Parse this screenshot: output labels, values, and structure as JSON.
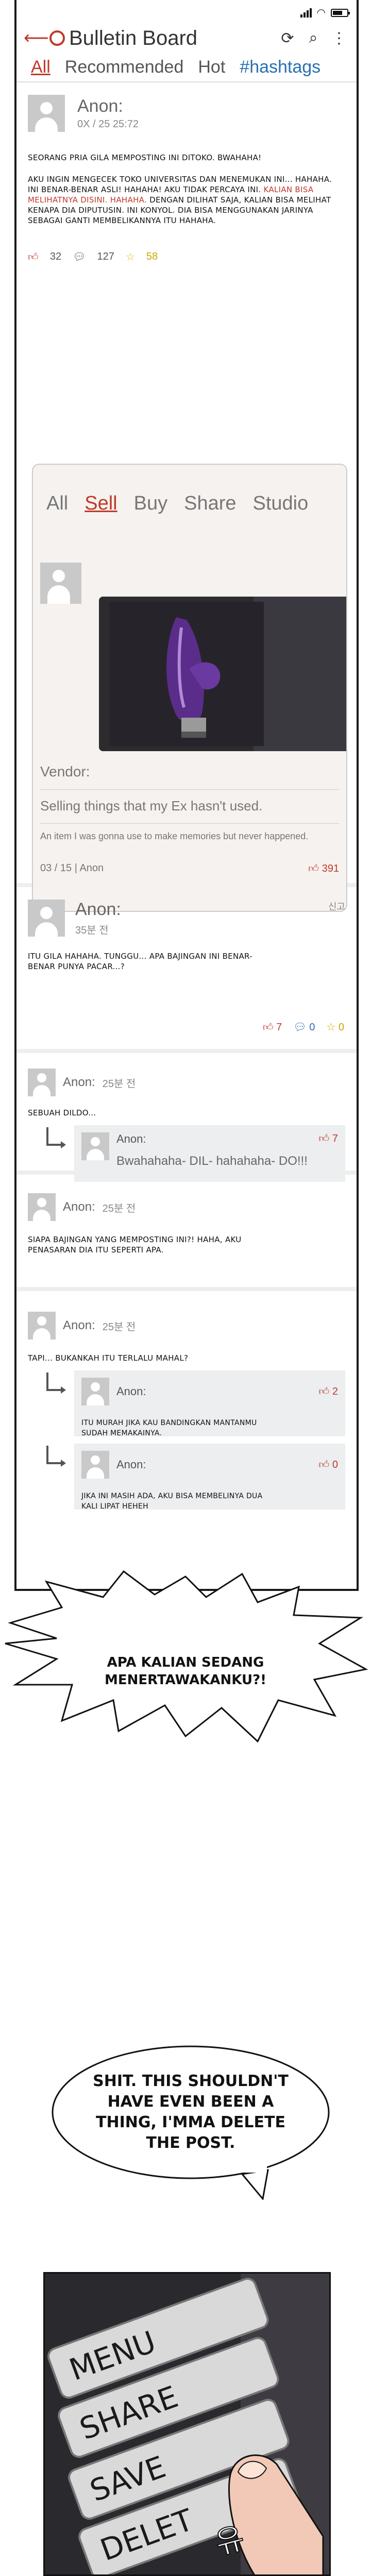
{
  "app": {
    "title": "Bulletin Board",
    "tabs": [
      "All",
      "Recommended",
      "Hot",
      "#hashtags"
    ],
    "active_tab": "All",
    "colors": {
      "accent": "#c0392b",
      "hashtag": "#2a6fb0",
      "background": "#ffffff"
    }
  },
  "post": {
    "user": "Anon:",
    "date": "0X / 25  25:72",
    "body_1": "Seorang pria gila memposting ini ditoko. Bwahaha!",
    "body_2": "Aku ingin mengecek toko universitas dan menemukan ini... Hahaha. Ini benar-benar asli! Hahaha! Aku tidak percaya ini.",
    "body_red": "Kalian bisa melihatnya disini. Hahaha.",
    "body_3": "Dengan dilihat saja, kalian bisa melihat kenapa dia diputusin. Ini konyol. Dia bisa menggunakan jarinya sebagai ganti membelikannya itu hahaha.",
    "likes": "32",
    "comments": "127",
    "stars": "58"
  },
  "embed": {
    "tabs": [
      "All",
      "Sell",
      "Buy",
      "Share",
      "Studio"
    ],
    "active_tab": "Sell",
    "vendor_label": "Vendor:",
    "desc": "Selling things that my Ex hasn't used.",
    "sub": "An item I was gonna use to make memories but never happened.",
    "footer_date": "03 / 15 | Anon",
    "likes": "391"
  },
  "comments": [
    {
      "user": "Anon:",
      "time": "35분 전",
      "report": "신고",
      "text": "Itu gila hahaha. Tunggu... Apa bajingan ini benar-benar punya pacar...?",
      "likes": "7",
      "comments": "0",
      "stars": "0"
    },
    {
      "user": "Anon:",
      "time": "25분 전",
      "text": "Sebuah dildo...",
      "reply": {
        "user": "Anon:",
        "text": "Bwahahaha- DIL- hahahaha- DO!!!",
        "likes": "7"
      }
    },
    {
      "user": "Anon:",
      "time": "25분 전",
      "text": "Siapa bajingan yang memposting ini?! Haha, aku penasaran dia itu seperti apa."
    },
    {
      "user": "Anon:",
      "time": "25분 전",
      "text": "Tapi... bukankah itu terlalu mahal?",
      "reply_1": {
        "user": "Anon:",
        "likes": "2",
        "text": "Itu murah jika kau bandingkan mantanmu sudah memakainya."
      },
      "reply_2": {
        "user": "Anon:",
        "likes": "0",
        "text": "Jika ini masih ada, aku bisa membelinya dua kali lipat heheh"
      }
    }
  ],
  "bubbles": {
    "shout": "Apa kalian sedang menertawakanku?!",
    "thought": "Shit. This shouldn't have even been a thing, I'mma delete the post."
  },
  "panel": {
    "menu": [
      "MENU",
      "SHARE",
      "SAVE",
      "DELET"
    ],
    "sfx": "유"
  }
}
